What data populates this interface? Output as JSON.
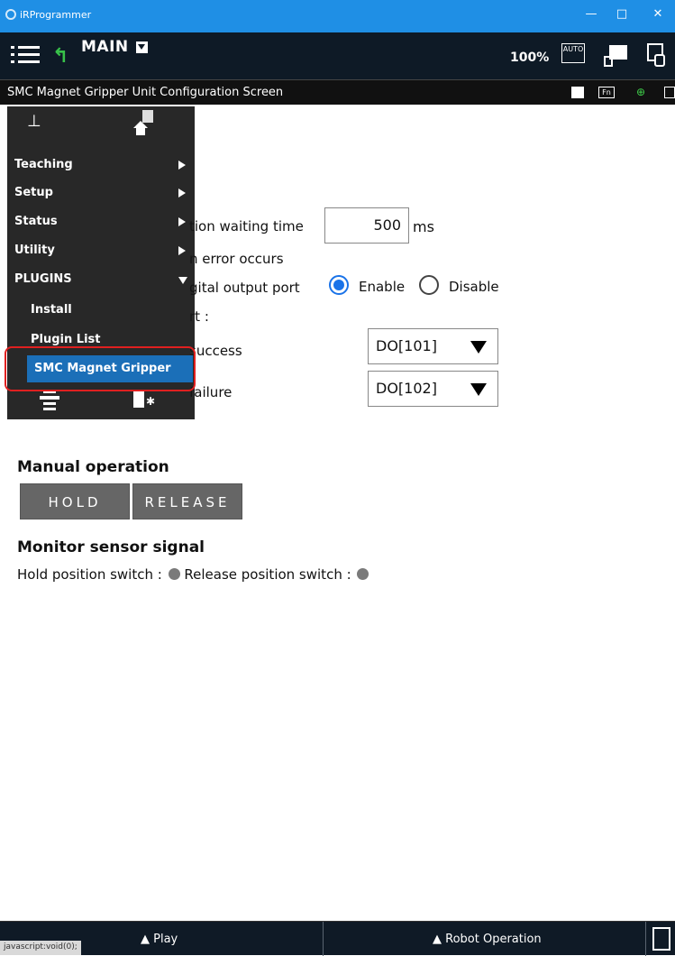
{
  "window": {
    "title": "iRProgrammer",
    "minimize": "—",
    "maximize": "□",
    "close": "✕"
  },
  "toolbar": {
    "main_label": "MAIN",
    "zoom": "100%",
    "auto_label": "AUTO"
  },
  "screen": {
    "title": "SMC Magnet Gripper Unit Configuration Screen",
    "fn_label": "Fn"
  },
  "settings": {
    "wait_time_label": "tion waiting time",
    "wait_time_value": "500",
    "wait_time_unit": "ms",
    "error_label": "n error occurs",
    "digital_output_label": "gital output port",
    "enable_label": "Enable",
    "disable_label": "Disable",
    "port_label": "rt :",
    "success_label": "success",
    "success_value": "DO[101]",
    "failure_label": "failure",
    "failure_value": "DO[102]"
  },
  "manual": {
    "title": "Manual operation",
    "hold": "HOLD",
    "release": "RELEASE"
  },
  "monitor": {
    "title": "Monitor sensor signal",
    "hold_switch": "Hold position switch :",
    "release_switch": "Release position switch :"
  },
  "menu": {
    "items": [
      {
        "label": "Teaching"
      },
      {
        "label": "Setup"
      },
      {
        "label": "Status"
      },
      {
        "label": "Utility"
      },
      {
        "label": "PLUGINS"
      }
    ],
    "sub_items": [
      {
        "label": "Install"
      },
      {
        "label": "Plugin List"
      },
      {
        "label": "SMC Magnet Gripper"
      }
    ]
  },
  "bottom": {
    "play": "▲ Play",
    "robot_operation": "▲ Robot Operation",
    "status_tip": "javascript:void(0);"
  },
  "colors": {
    "title_bar": "#1f8fe5",
    "toolbar": "#0e1a26",
    "radio_on": "#1a73e8",
    "selected_menu": "#1b6fb8",
    "highlight": "#e02020"
  }
}
